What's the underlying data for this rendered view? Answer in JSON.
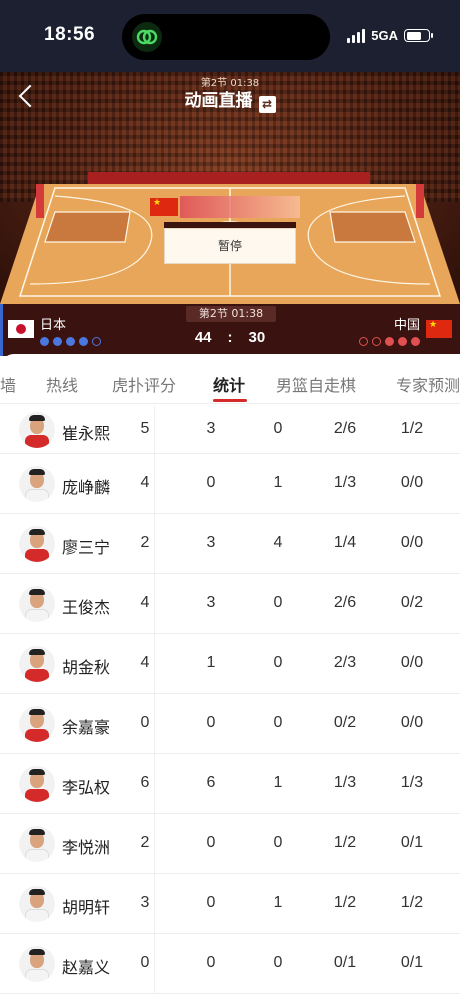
{
  "status": {
    "time": "18:56",
    "network": "5GA"
  },
  "header": {
    "period_top": "第2节  01:38",
    "title": "动画直播",
    "switch_icon": "swap-icon"
  },
  "court": {
    "pause_label": "暂停"
  },
  "scoreboard": {
    "period": "第2节  01:38",
    "home": {
      "name": "日本",
      "score": "44",
      "timeouts_on": 4,
      "timeouts_total": 5,
      "flag_icon": "japan-flag-icon"
    },
    "away": {
      "name": "中国",
      "score": "30",
      "timeouts_on": 3,
      "timeouts_total": 5,
      "flag_icon": "china-flag-icon"
    },
    "separator": ":"
  },
  "tabs": [
    "墙",
    "热线",
    "虎扑评分",
    "统计",
    "男篮自走棋",
    "专家预测"
  ],
  "active_tab": "统计",
  "players": [
    {
      "name": "崔永熙",
      "stats": [
        "5",
        "3",
        "0",
        "2/6",
        "1/2"
      ],
      "jersey": "red"
    },
    {
      "name": "庞峥麟",
      "stats": [
        "4",
        "0",
        "1",
        "1/3",
        "0/0"
      ],
      "jersey": "white"
    },
    {
      "name": "廖三宁",
      "stats": [
        "2",
        "3",
        "4",
        "1/4",
        "0/0"
      ],
      "jersey": "red"
    },
    {
      "name": "王俊杰",
      "stats": [
        "4",
        "3",
        "0",
        "2/6",
        "0/2"
      ],
      "jersey": "white"
    },
    {
      "name": "胡金秋",
      "stats": [
        "4",
        "1",
        "0",
        "2/3",
        "0/0"
      ],
      "jersey": "red"
    },
    {
      "name": "余嘉豪",
      "stats": [
        "0",
        "0",
        "0",
        "0/2",
        "0/0"
      ],
      "jersey": "red"
    },
    {
      "name": "李弘权",
      "stats": [
        "6",
        "6",
        "1",
        "1/3",
        "1/3"
      ],
      "jersey": "red"
    },
    {
      "name": "李悦洲",
      "stats": [
        "2",
        "0",
        "0",
        "1/2",
        "0/1"
      ],
      "jersey": "white"
    },
    {
      "name": "胡明轩",
      "stats": [
        "3",
        "0",
        "1",
        "1/2",
        "1/2"
      ],
      "jersey": "white"
    },
    {
      "name": "赵嘉义",
      "stats": [
        "0",
        "0",
        "0",
        "0/1",
        "0/1"
      ],
      "jersey": "white"
    }
  ],
  "colors": {
    "accent": "#d42a2a",
    "scoreboard_bg": "#3a1210",
    "status_bg": "#1c2030"
  }
}
